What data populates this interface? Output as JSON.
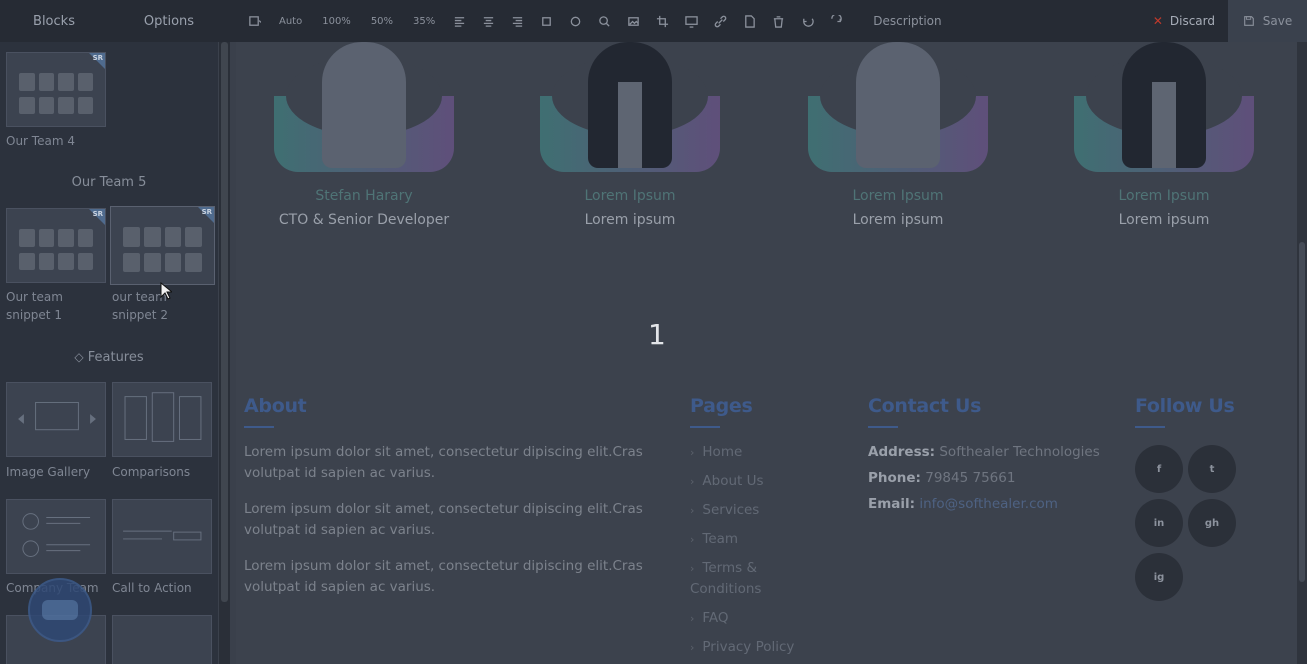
{
  "toolbar": {
    "tabs": [
      "Blocks",
      "Options"
    ],
    "zoom": [
      "Auto",
      "100%",
      "50%",
      "35%"
    ],
    "description_label": "Description",
    "discard_label": "Discard",
    "save_label": "Save"
  },
  "sidebar": {
    "sections": [
      {
        "title": "Our Team 5"
      },
      {
        "title": "Features"
      }
    ],
    "blocks": [
      {
        "label": "Our Team 4"
      },
      {
        "label": "Our team snippet 1"
      },
      {
        "label": "our team snippet 2"
      },
      {
        "label": "Image Gallery"
      },
      {
        "label": "Comparisons"
      },
      {
        "label": "Company Team"
      },
      {
        "label": "Call to Action"
      }
    ],
    "badge": "SR"
  },
  "team": {
    "members": [
      {
        "name": "Stefan Harary",
        "role": "CTO & Senior Developer",
        "photo": "woman"
      },
      {
        "name": "Lorem Ipsum",
        "role": "Lorem ipsum",
        "photo": "man"
      },
      {
        "name": "Lorem Ipsum",
        "role": "Lorem ipsum",
        "photo": "woman"
      },
      {
        "name": "Lorem Ipsum",
        "role": "Lorem ipsum",
        "photo": "man"
      }
    ]
  },
  "overlay_number": "1",
  "footer": {
    "about": {
      "heading": "About",
      "paragraphs": [
        "Lorem ipsum dolor sit amet, consectetur dipiscing elit.Cras volutpat id sapien ac varius.",
        "Lorem ipsum dolor sit amet, consectetur dipiscing elit.Cras volutpat id sapien ac varius.",
        "Lorem ipsum dolor sit amet, consectetur dipiscing elit.Cras volutpat id sapien ac varius."
      ]
    },
    "pages": {
      "heading": "Pages",
      "links": [
        "Home",
        "About Us",
        "Services",
        "Team",
        "Terms & Conditions",
        "FAQ",
        "Privacy Policy"
      ]
    },
    "contact": {
      "heading": "Contact Us",
      "address_label": "Address:",
      "address_value": "Softhealer Technologies",
      "phone_label": "Phone:",
      "phone_value": "79845 75661",
      "email_label": "Email:",
      "email_value": "info@softhealer.com"
    },
    "follow": {
      "heading": "Follow Us",
      "icons": [
        "f",
        "t",
        "in",
        "gh",
        "ig"
      ]
    }
  }
}
